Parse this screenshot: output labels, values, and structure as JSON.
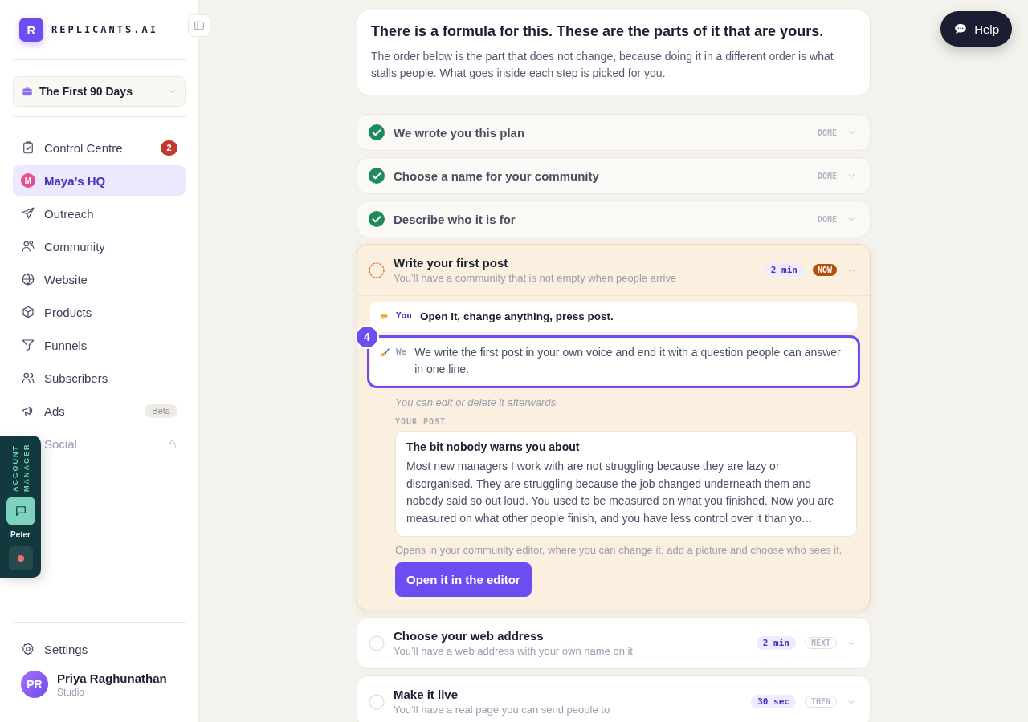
{
  "brand": {
    "mark": "R",
    "name": "REPLICANTS.AI"
  },
  "workspace": {
    "label": "The First 90 Days"
  },
  "nav": [
    {
      "label": "Control Centre",
      "selected": false,
      "locked": false,
      "count": "2"
    },
    {
      "label": "Maya’s HQ",
      "selected": true,
      "locked": false,
      "avatar": "M"
    },
    {
      "label": "Outreach",
      "selected": false,
      "locked": false
    },
    {
      "label": "Community",
      "selected": false,
      "locked": false
    },
    {
      "label": "Website",
      "selected": false,
      "locked": false
    },
    {
      "label": "Products",
      "selected": false,
      "locked": false
    },
    {
      "label": "Funnels",
      "selected": false,
      "locked": false
    },
    {
      "label": "Subscribers",
      "selected": false,
      "locked": false
    },
    {
      "label": "Ads",
      "selected": false,
      "locked": false,
      "tag": "Beta"
    },
    {
      "label": "Social",
      "selected": false,
      "locked": true
    }
  ],
  "settings": {
    "label": "Settings"
  },
  "user": {
    "initials": "PR",
    "name": "Priya Raghunathan",
    "plan": "Studio"
  },
  "account_manager": {
    "title": "ACCOUNT MANAGER",
    "name": "Peter",
    "recording": true
  },
  "help": {
    "label": "Help"
  },
  "intro": {
    "title": "There is a formula for this. These are the parts of it that are yours.",
    "text": "The order below is the part that does not change, because doing it in a different order is what stalls people. What goes inside each step is picked for you."
  },
  "steps": [
    {
      "kind": "done",
      "title": "We wrote you this plan",
      "status": "DONE",
      "expanded": false
    },
    {
      "kind": "done",
      "title": "Choose a name for your community",
      "status": "DONE",
      "expanded": false
    },
    {
      "kind": "done",
      "title": "Describe who it is for",
      "status": "DONE",
      "expanded": false
    },
    {
      "kind": "current",
      "title": "Write your first post",
      "subtitle": "You’ll have a community that is not empty when people arrive",
      "time": "2 min",
      "status": "NOW",
      "expanded": true,
      "detail": {
        "roles": [
          {
            "kind": "you",
            "label": "You",
            "text": "Open it, change anything, press post.",
            "highlighted": false
          },
          {
            "kind": "we",
            "label": "We",
            "text": "We write the first post in your own voice and end it with a question people can answer in one line.",
            "highlighted": true,
            "marker": "4"
          }
        ],
        "note": "You can edit or delete it afterwards.",
        "post_label": "YOUR POST",
        "post": {
          "title": "The bit nobody warns you about",
          "body": "Most new managers I work with are not struggling because they are lazy or disorganised. They are struggling because the job changed underneath them and nobody said so out loud. You used to be measured on what you finished. Now you are measured on what other people finish, and you have less control over it than yo…"
        },
        "hint": "Opens in your community editor, where you can change it, add a picture and choose who sees it.",
        "button": "Open it in the editor"
      }
    },
    {
      "kind": "upcoming",
      "title": "Choose your web address",
      "subtitle": "You’ll have a web address with your own name on it",
      "time": "2 min",
      "status": "NEXT",
      "expanded": false
    },
    {
      "kind": "upcoming",
      "title": "Make it live",
      "subtitle": "You’ll have a real page you can send people to",
      "time": "30 sec",
      "status": "THEN",
      "expanded": false
    }
  ]
}
